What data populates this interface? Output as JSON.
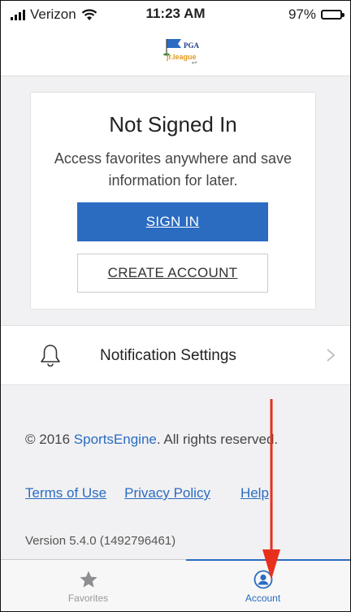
{
  "status_bar": {
    "carrier": "Verizon",
    "time": "11:23 AM",
    "battery": "97%",
    "battery_level": 0.97
  },
  "header": {
    "logo_text_top": "PGA",
    "logo_text_bottom": "jr.league",
    "logo_text_small": "golf"
  },
  "signin_card": {
    "title": "Not Signed In",
    "message": "Access favorites anywhere and save information for later.",
    "sign_in_label": "SIGN IN",
    "create_account_label": "CREATE ACCOUNT"
  },
  "notifications": {
    "label": "Notification Settings"
  },
  "footer": {
    "copyright_prefix": "© 2016 ",
    "copyright_brand": "SportsEngine",
    "copyright_suffix": ". All rights reserved.",
    "links": [
      "Terms of Use",
      "Privacy Policy",
      "Help"
    ],
    "version": "Version 5.4.0 (1492796461)"
  },
  "tabbar": {
    "tabs": [
      {
        "label": "Favorites",
        "icon": "star-icon",
        "active": false
      },
      {
        "label": "Account",
        "icon": "account-icon",
        "active": true
      }
    ]
  },
  "colors": {
    "accent": "#2b6cc1",
    "annotation_arrow": "#e8301c"
  }
}
